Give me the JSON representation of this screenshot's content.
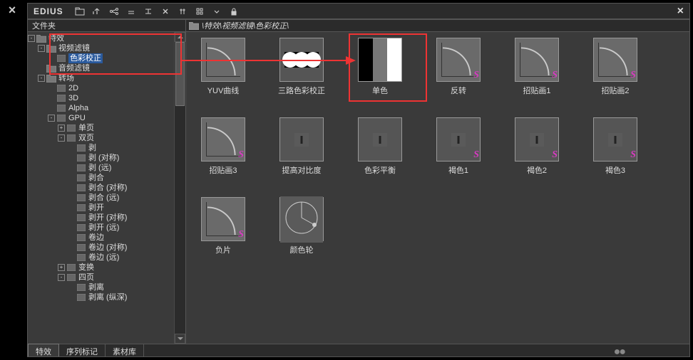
{
  "app": {
    "name": "EDIUS"
  },
  "sidebar": {
    "header": "文件夹",
    "tree": {
      "root": "特效",
      "video_filter": "视频滤镜",
      "color_correction": "色彩校正",
      "audio_filter": "音频滤镜",
      "transition": "转场",
      "t2d": "2D",
      "t3d": "3D",
      "alpha": "Alpha",
      "gpu": "GPU",
      "single_page": "单页",
      "double_page": "双页",
      "peel": "剥",
      "peel_sym": "剥 (对称)",
      "peel_far": "剥 (远)",
      "peel_join": "剥合",
      "peel_join_sym": "剥合 (对称)",
      "peel_join_far": "剥合 (远)",
      "peel_open": "剥开",
      "peel_open_sym": "剥开 (对称)",
      "peel_open_far": "剥开 (远)",
      "roll": "卷边",
      "roll_sym": "卷边 (对称)",
      "roll_far": "卷边 (远)",
      "transform": "变换",
      "four_page": "四页",
      "peel_off": "剥离",
      "peel_off_vert": "剥离 (纵深)"
    }
  },
  "breadcrumb": "\\特效\\视频滤镜\\色彩校正\\",
  "effects": [
    {
      "label": "YUV曲线",
      "kind": "curve",
      "badge": false
    },
    {
      "label": "三路色彩校正",
      "kind": "three-circles",
      "badge": false
    },
    {
      "label": "单色",
      "kind": "mono",
      "badge": false
    },
    {
      "label": "反转",
      "kind": "curve",
      "badge": true
    },
    {
      "label": "招贴画1",
      "kind": "curve",
      "badge": true
    },
    {
      "label": "招贴画2",
      "kind": "curve",
      "badge": true
    },
    {
      "label": "招贴画3",
      "kind": "curve",
      "badge": true
    },
    {
      "label": "提高对比度",
      "kind": "sliders",
      "badge": false
    },
    {
      "label": "色彩平衡",
      "kind": "sliders",
      "badge": false
    },
    {
      "label": "褐色1",
      "kind": "sliders",
      "badge": true
    },
    {
      "label": "褐色2",
      "kind": "sliders",
      "badge": true
    },
    {
      "label": "褐色3",
      "kind": "sliders",
      "badge": true
    },
    {
      "label": "负片",
      "kind": "curve",
      "badge": true
    },
    {
      "label": "颜色轮",
      "kind": "colorwheel",
      "badge": false
    }
  ],
  "tabs": [
    {
      "label": "特效",
      "active": true
    },
    {
      "label": "序列标记",
      "active": false
    },
    {
      "label": "素材库",
      "active": false
    }
  ],
  "annotations": {
    "highlighted_effect_index": 2
  }
}
